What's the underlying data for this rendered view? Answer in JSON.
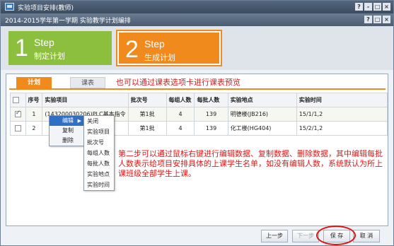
{
  "window": {
    "title": "实验项目安排(教师)",
    "buttons": [
      "?",
      "-",
      "□",
      "×"
    ]
  },
  "subwindow": {
    "title": "2014-2015学年第一学期 实验教学计划编排",
    "buttons": [
      "?",
      "□",
      "×"
    ]
  },
  "steps": [
    {
      "num": "1",
      "label": "Step",
      "sublabel": "制定计划",
      "color": "#8cbf3d"
    },
    {
      "num": "2",
      "label": "Step",
      "sublabel": "生成计划",
      "color": "#f08a1c",
      "active": true
    }
  ],
  "tabs": [
    {
      "label": "计划",
      "active": true
    },
    {
      "label": "课表",
      "active": false
    }
  ],
  "annotations": {
    "tabs_hint": "也可以通过课表选项卡进行课表预览",
    "context_hint": "第二步可以通过鼠标右键进行编辑数据、复制数据、删除数据，其中编辑每批人数表示给项目安排具体的上课学生名单，如没有编辑人数，系统默认为所上课班级全部学生上课。"
  },
  "table": {
    "headers": [
      "",
      "序号",
      "实验项目",
      "批次号",
      "每组人数",
      "每批人数",
      "实验地点",
      "实验时间"
    ],
    "rows": [
      {
        "checked": true,
        "no": "1",
        "project": "(143200030206)PLC基本指令",
        "batch": "第1批",
        "group": "4",
        "per_batch": "139",
        "location": "明德楼(JB216)",
        "time": "15/1/1,2"
      },
      {
        "checked": false,
        "no": "2",
        "project": "",
        "batch": "第1批",
        "group": "4",
        "per_batch": "139",
        "location": "化工楼(HG404)",
        "time": "15/2/1,2"
      }
    ]
  },
  "context_menu": {
    "items": [
      {
        "label": "编辑",
        "highlighted": true,
        "has_submenu": true
      },
      {
        "label": "复制"
      },
      {
        "label": "删除"
      }
    ],
    "submenu": [
      "关闭",
      "实验项目",
      "批次号",
      "每组人数",
      "每批人数",
      "实验地点",
      "实验时间"
    ]
  },
  "footer": {
    "prev": "上一步",
    "next": "下一步",
    "save": "保 存",
    "cancel": "取 消"
  },
  "colors": {
    "accent_orange": "#f08a1c",
    "accent_green": "#8cbf3d",
    "highlight_red": "#e01818"
  }
}
